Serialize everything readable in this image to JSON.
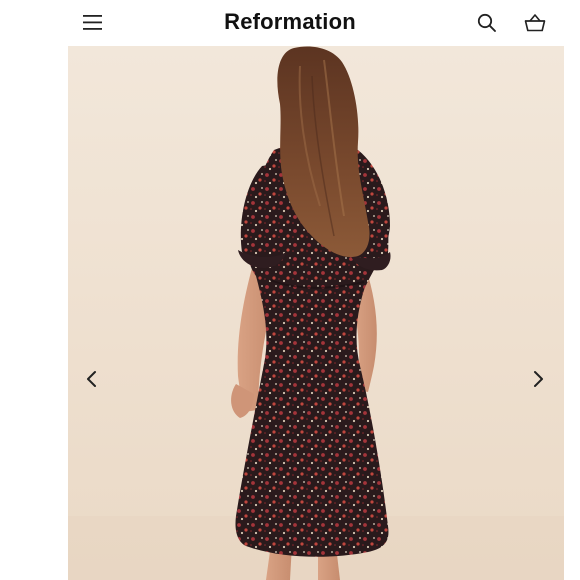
{
  "header": {
    "brand": "Reformation",
    "icons": {
      "menu": "hamburger-menu-icon",
      "search": "search-icon",
      "bag": "shopping-basket-icon"
    }
  },
  "gallery": {
    "image": "model-back-view-floral-midi-dress",
    "prev_icon": "chevron-left-icon",
    "next_icon": "chevron-right-icon"
  },
  "colors": {
    "text": "#111111",
    "backdrop": "#efe1d1",
    "dress": "#2a1a1c",
    "hair": "#6b3f28"
  }
}
